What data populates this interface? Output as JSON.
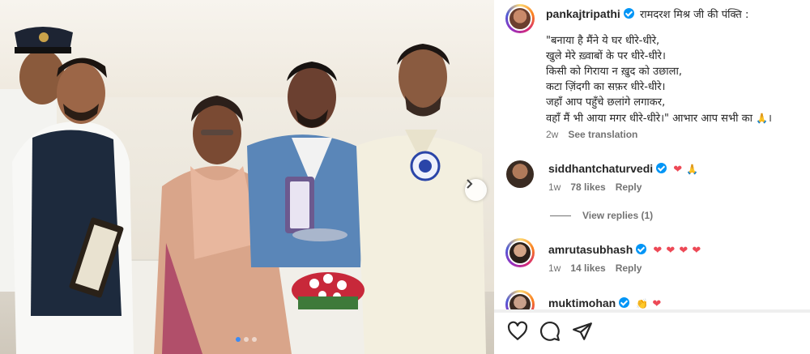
{
  "post": {
    "author": "pankajtripathi",
    "caption_title": "रामदरश मिश्र जी की पंक्ति :",
    "poem_lines": [
      "\"बनाया है मैंने ये घर धीरे-धीरे,",
      "खुले मेरे ख़्वाबों के पर धीरे-धीरे।",
      "किसी को गिराया न ख़ुद को उछाला,",
      "कटा ज़िंदगी का सफ़र धीरे-धीरे।",
      "जहाँ आप पहुँचे छलांगे लगाकर,",
      "वहाँ मैं भी आया मगर धीरे-धीरे।\" आभार आप सभी का"
    ],
    "time": "2w",
    "see_translation": "See translation"
  },
  "comments": [
    {
      "user": "siddhantchaturvedi",
      "time": "1w",
      "likes": "78 likes",
      "reply": "Reply"
    },
    {
      "user": "amrutasubhash",
      "time": "1w",
      "likes": "14 likes",
      "reply": "Reply"
    },
    {
      "user": "muktimohan"
    }
  ],
  "view_replies": "View replies (1)",
  "icons": {
    "like": "heart-outline-icon",
    "comment": "comment-bubble-icon",
    "share": "paper-plane-icon",
    "next": "chevron-right-icon",
    "verified": "verified-badge-icon"
  },
  "colors": {
    "verified": "#0095f6",
    "heart": "#ed4956",
    "meta": "#737373",
    "carousel_active": "#3b8bf5"
  }
}
